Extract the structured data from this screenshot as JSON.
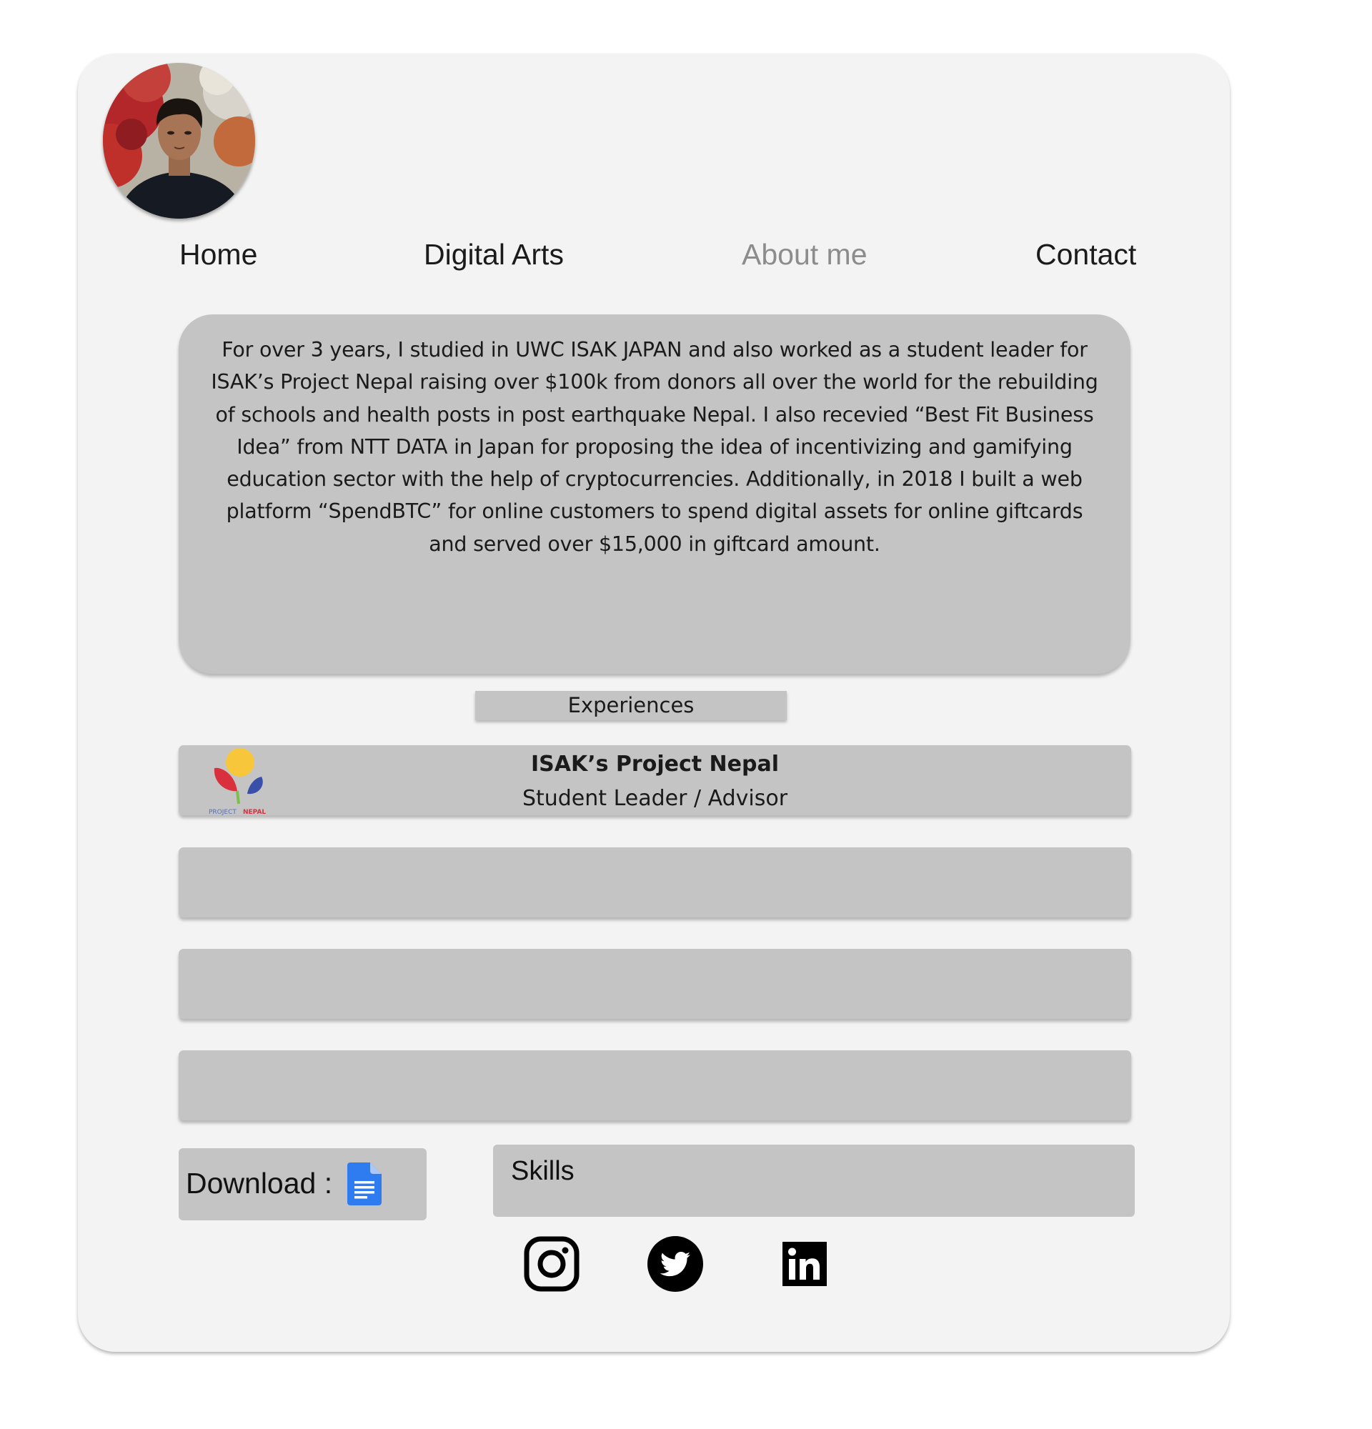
{
  "profile": {
    "avatar_alt": "Profile photo"
  },
  "nav": {
    "items": [
      {
        "label": "Home"
      },
      {
        "label": "Digital Arts"
      },
      {
        "label": "About me",
        "active": true
      },
      {
        "label": "Contact"
      }
    ]
  },
  "about": {
    "text": "For over 3 years, I studied in UWC ISAK JAPAN and also worked as a student leader for ISAK’s Project Nepal raising over $100k from donors all over the world for the rebuilding of schools and health posts in post earthquake Nepal. I also recevied “Best Fit Business Idea” from NTT DATA in Japan for proposing the idea of incentivizing and gamifying education sector with the help of cryptocurrencies. Additionally, in 2018 I built a web platform “SpendBTC” for online customers to spend digital assets for online giftcards and served over $15,000 in giftcard amount."
  },
  "experiences": {
    "title": "Experiences",
    "items": [
      {
        "name": "ISAK’s Project Nepal",
        "role": "Student Leader / Advisor",
        "logo_text_project": "PROJECT ",
        "logo_text_nepal": "NEPAL"
      },
      {
        "name": "",
        "role": ""
      },
      {
        "name": "",
        "role": ""
      },
      {
        "name": "",
        "role": ""
      }
    ]
  },
  "download": {
    "label": "Download :",
    "icon": "google-docs-icon"
  },
  "skills": {
    "label": "Skills"
  },
  "social": {
    "icons": [
      "instagram-icon",
      "twitter-icon",
      "linkedin-icon"
    ]
  },
  "colors": {
    "card_bg": "#f3f3f3",
    "box_bg": "#c4c4c4",
    "nav_active": "#8c8c8c",
    "text": "#1a1a1a"
  }
}
